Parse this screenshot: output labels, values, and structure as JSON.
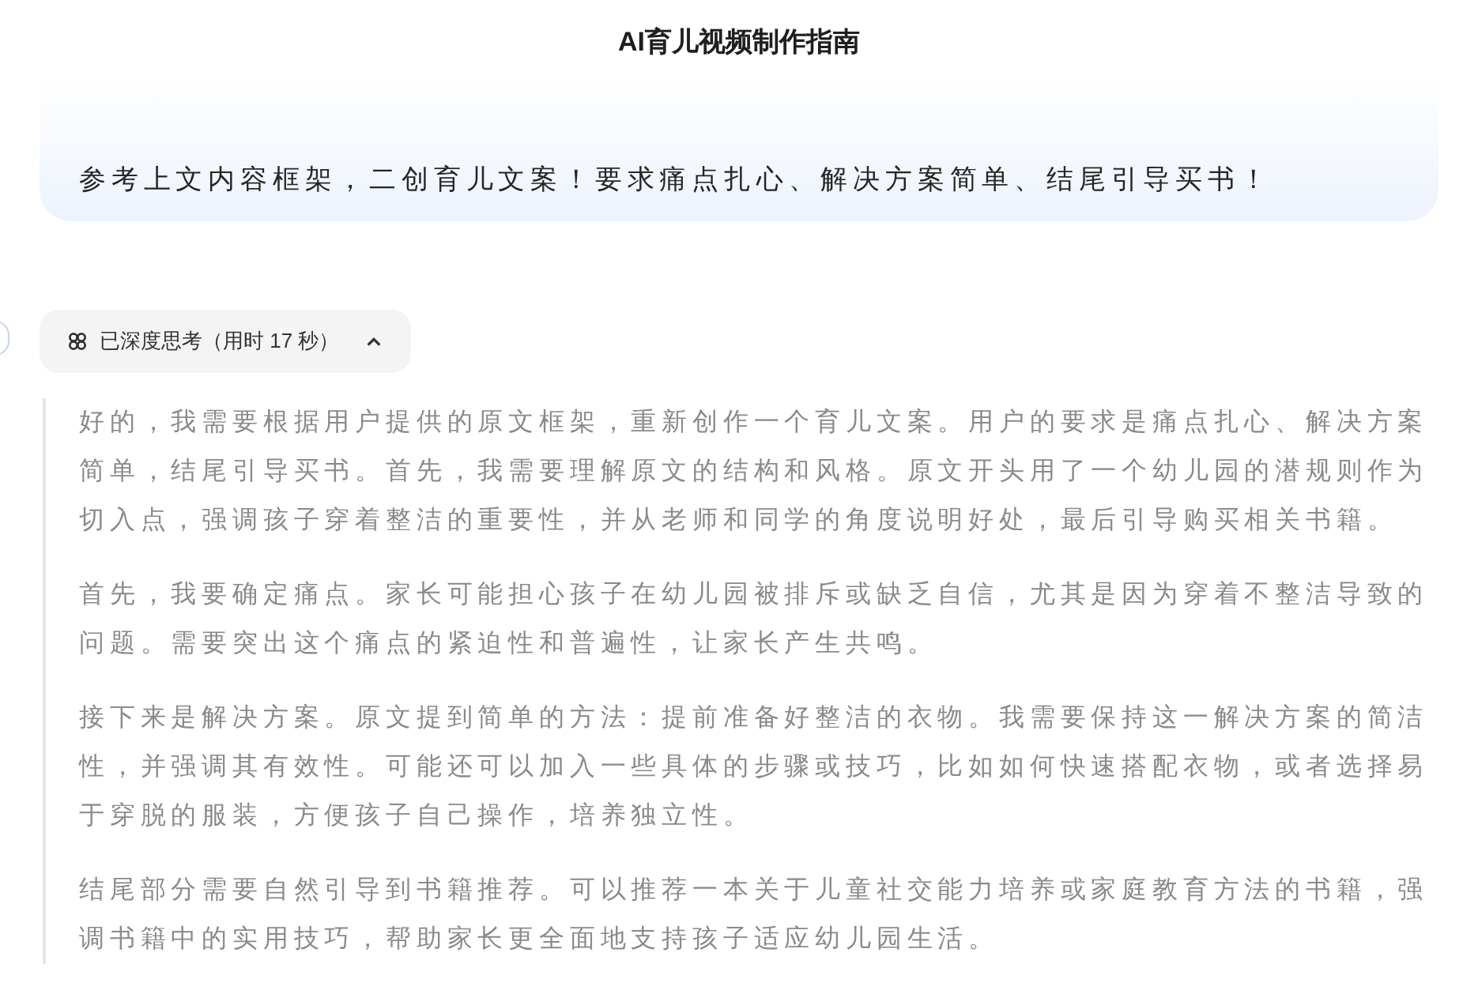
{
  "header": {
    "title": "AI育儿视频制作指南"
  },
  "user_message": {
    "text": "参考上文内容框架，二创育儿文案！要求痛点扎心、解决方案简单、结尾引导买书！"
  },
  "thinking": {
    "label": "已深度思考（用时 17 秒）",
    "expanded": true,
    "paragraphs": [
      "好的，我需要根据用户提供的原文框架，重新创作一个育儿文案。用户的要求是痛点扎心、解决方案简单，结尾引导买书。首先，我需要理解原文的结构和风格。原文开头用了一个幼儿园的潜规则作为切入点，强调孩子穿着整洁的重要性，并从老师和同学的角度说明好处，最后引导购买相关书籍。",
      "首先，我要确定痛点。家长可能担心孩子在幼儿园被排斥或缺乏自信，尤其是因为穿着不整洁导致的问题。需要突出这个痛点的紧迫性和普遍性，让家长产生共鸣。",
      "接下来是解决方案。原文提到简单的方法：提前准备好整洁的衣物。我需要保持这一解决方案的简洁性，并强调其有效性。可能还可以加入一些具体的步骤或技巧，比如如何快速搭配衣物，或者选择易于穿脱的服装，方便孩子自己操作，培养独立性。",
      "结尾部分需要自然引导到书籍推荐。可以推荐一本关于儿童社交能力培养或家庭教育方法的书籍，强调书籍中的实用技巧，帮助家长更全面地支持孩子适应幼儿园生活。"
    ]
  }
}
